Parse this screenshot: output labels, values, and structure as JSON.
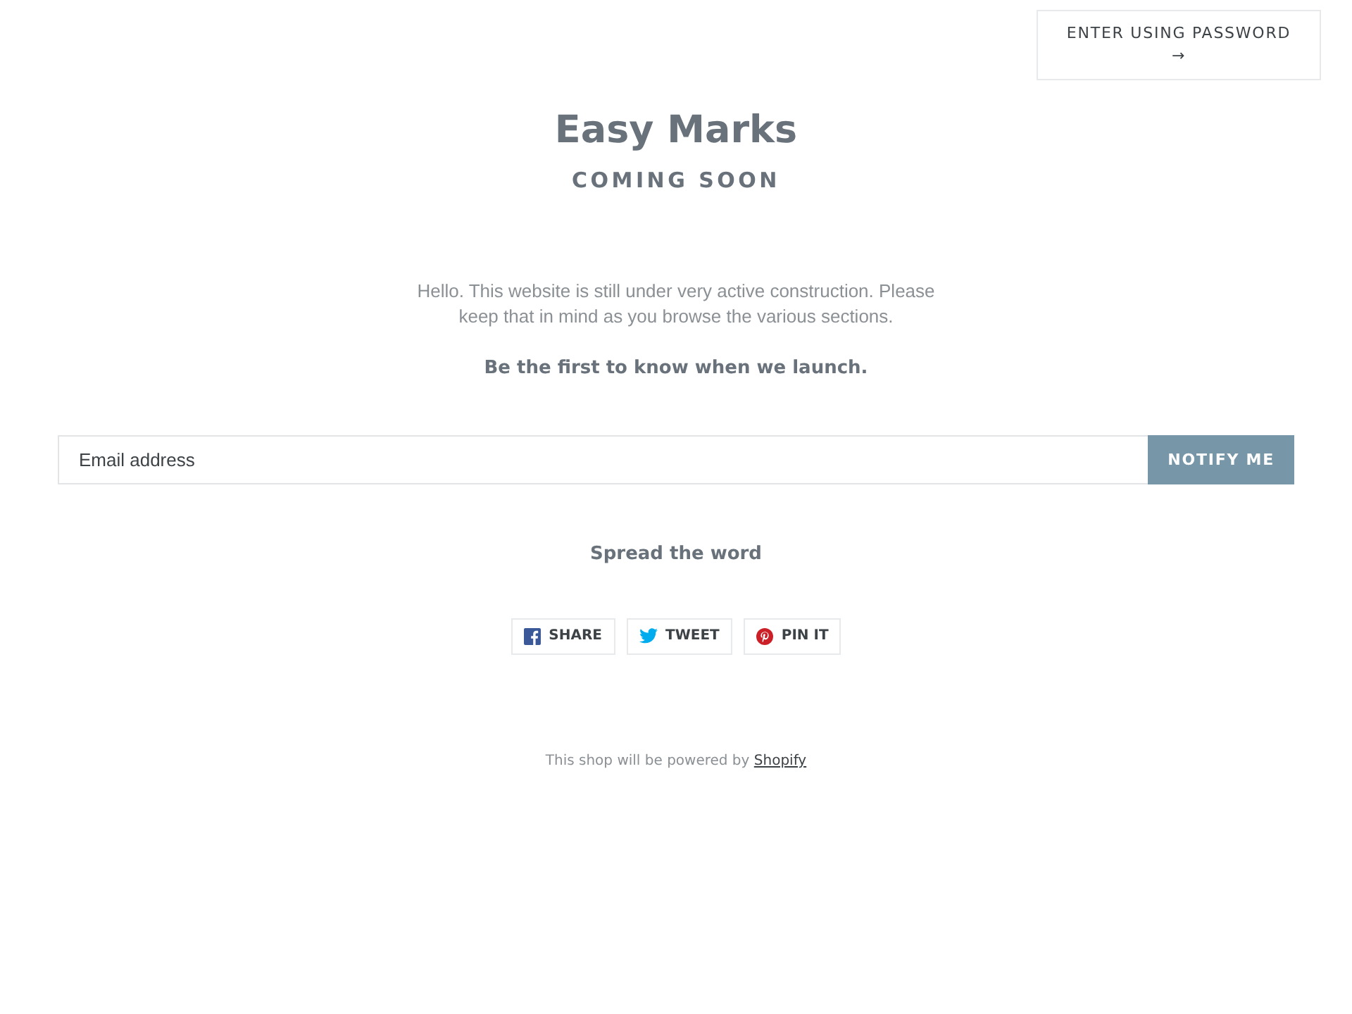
{
  "password_button": {
    "label": "ENTER USING PASSWORD",
    "arrow": "→"
  },
  "header": {
    "title": "Easy Marks",
    "subtitle": "COMING SOON"
  },
  "intro": "Hello. This website is still under very active construction. Please keep that in mind as you browse the various sections.",
  "signup": {
    "heading": "Be the first to know when we launch.",
    "placeholder": "Email address",
    "button": "NOTIFY ME"
  },
  "share": {
    "heading": "Spread the word",
    "buttons": [
      {
        "kind": "facebook",
        "label": "SHARE"
      },
      {
        "kind": "twitter",
        "label": "TWEET"
      },
      {
        "kind": "pinterest",
        "label": "PIN IT"
      }
    ]
  },
  "footer": {
    "text": "This shop will be powered by",
    "link": "Shopify"
  }
}
